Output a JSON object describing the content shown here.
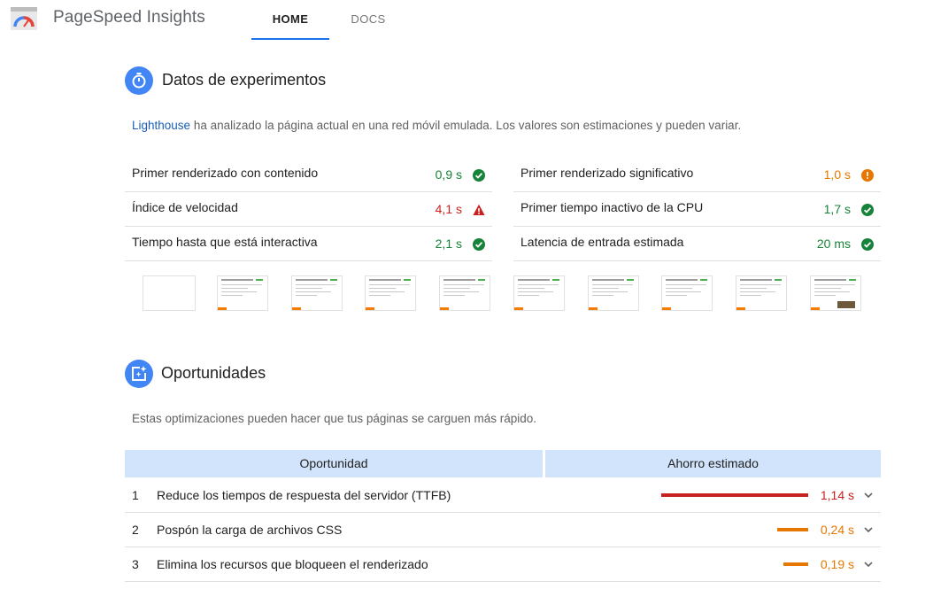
{
  "header": {
    "brand": "PageSpeed Insights",
    "tabs": [
      {
        "label": "HOME",
        "active": true
      },
      {
        "label": "DOCS",
        "active": false
      }
    ],
    "accent_color": "#1a73e8"
  },
  "lab": {
    "icon": "stopwatch-icon",
    "title": "Datos de experimentos",
    "desc_link": "Lighthouse",
    "desc_text": " ha analizado la página actual en una red móvil emulada. Los valores son estimaciones y pueden variar.",
    "metrics": [
      {
        "label": "Primer renderizado con contenido",
        "value": "0,9 s",
        "status": "pass",
        "icon": "check-circle-icon"
      },
      {
        "label": "Índice de velocidad",
        "value": "4,1 s",
        "status": "fail",
        "icon": "warning-triangle-icon"
      },
      {
        "label": "Tiempo hasta que está interactiva",
        "value": "2,1 s",
        "status": "pass",
        "icon": "check-circle-icon"
      },
      {
        "label": "Primer renderizado significativo",
        "value": "1,0 s",
        "status": "average",
        "icon": "info-circle-icon"
      },
      {
        "label": "Primer tiempo inactivo de la CPU",
        "value": "1,7 s",
        "status": "pass",
        "icon": "check-circle-icon"
      },
      {
        "label": "Latencia de entrada estimada",
        "value": "20 ms",
        "status": "pass",
        "icon": "check-circle-icon"
      }
    ]
  },
  "opportunities": {
    "icon": "opportunity-icon",
    "title": "Oportunidades",
    "desc": "Estas optimizaciones pueden hacer que tus páginas se carguen más rápido.",
    "col_opportunity": "Oportunidad",
    "col_savings": "Ahorro estimado",
    "rows": [
      {
        "num": "1",
        "label": "Reduce los tiempos de respuesta del servidor (TTFB)",
        "value": "1,14 s",
        "savings_fraction": 1.0,
        "status": "fail",
        "bar_color": "#c7221f"
      },
      {
        "num": "2",
        "label": "Pospón la carga de archivos CSS",
        "value": "0,24 s",
        "savings_fraction": 0.21,
        "status": "average",
        "bar_color": "#e67700"
      },
      {
        "num": "3",
        "label": "Elimina los recursos que bloqueen el renderizado",
        "value": "0,19 s",
        "savings_fraction": 0.17,
        "status": "average",
        "bar_color": "#e67700"
      }
    ]
  },
  "colors": {
    "pass": "#178239",
    "average": "#e67700",
    "fail": "#c7221f",
    "table_header": "#d1e4fb",
    "section_icon": "#4285f4"
  }
}
